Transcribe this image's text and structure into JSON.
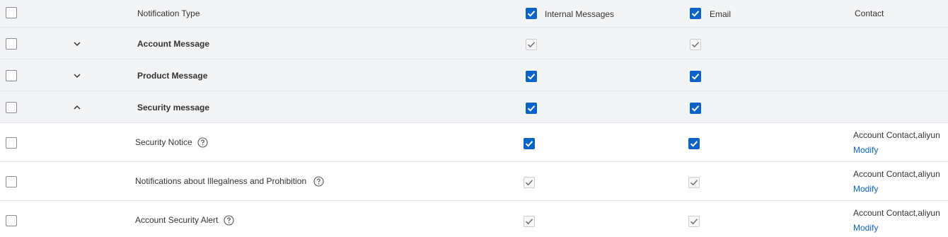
{
  "header": {
    "type_label": "Notification Type",
    "internal_label": "Internal Messages",
    "email_label": "Email",
    "contact_label": "Contact"
  },
  "groups": [
    {
      "label": "Account Message",
      "expanded": false
    },
    {
      "label": "Product Message",
      "expanded": false
    },
    {
      "label": "Security message",
      "expanded": true
    }
  ],
  "items": [
    {
      "label": "Security Notice",
      "contact": "Account Contact,aliyun",
      "action": "Modify"
    },
    {
      "label": "Notifications about Illegalness and Prohibition",
      "contact": "Account Contact,aliyun",
      "action": "Modify"
    },
    {
      "label": "Account Security Alert",
      "contact": "Account Contact,aliyun",
      "action": "Modify"
    }
  ],
  "colors": {
    "accent": "#0a63c9",
    "header_bg": "#f3f4f6",
    "border": "#e3e6ea"
  }
}
